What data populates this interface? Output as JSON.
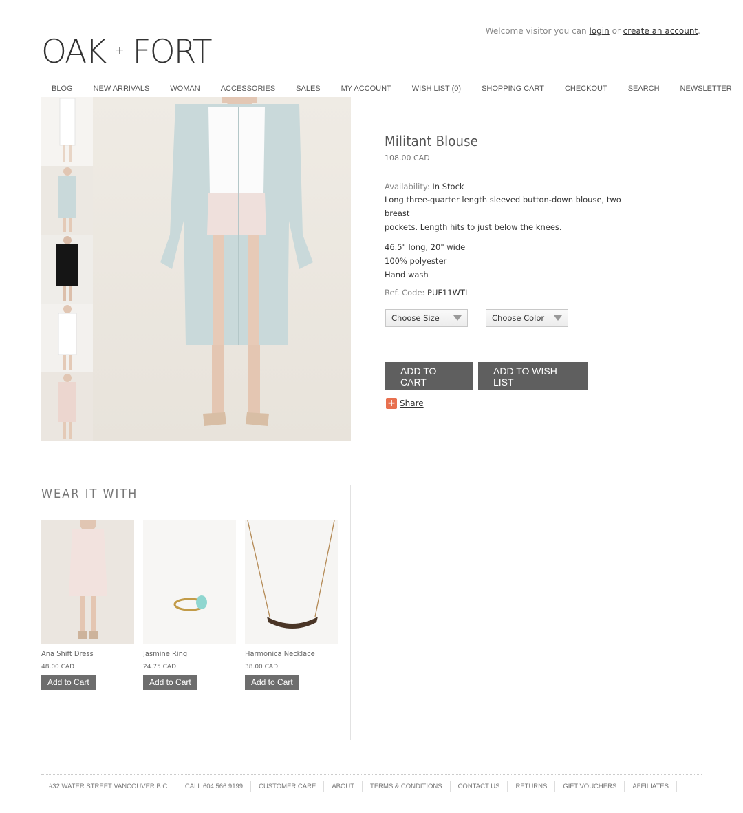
{
  "header": {
    "welcome_prefix": "Welcome visitor you can",
    "login_label": "login",
    "or_text": "or",
    "create_account_label": "create an account",
    "end_punct": ".",
    "logo_left": "OAK",
    "logo_plus": "+",
    "logo_right": "FORT"
  },
  "nav": [
    "BLOG",
    "NEW ARRIVALS",
    "WOMAN",
    "ACCESSORIES",
    "SALES",
    "MY ACCOUNT",
    "WISH LIST (0)",
    "SHOPPING CART",
    "CHECKOUT",
    "SEARCH",
    "NEWSLETTER"
  ],
  "product": {
    "title": "Militant Blouse",
    "price": "108.00 CAD",
    "availability_label": "Availability:",
    "availability_value": "In Stock",
    "description_line1": "Long three-quarter length sleeved button-down blouse, two breast",
    "description_line2": "pockets. Length hits to just below the knees.",
    "spec_1": "46.5\" long, 20\" wide",
    "spec_2": "100% polyester",
    "spec_3": "Hand wash",
    "ref_label": "Ref. Code:",
    "ref_value": "PUF11WTL",
    "size_select": "Choose Size",
    "color_select": "Choose Color",
    "add_to_cart": "ADD TO CART",
    "add_to_wishlist": "ADD TO WISH LIST",
    "share_icon": "+",
    "share_label": "Share"
  },
  "wear_it_with": {
    "title": "WEAR IT WITH",
    "items": [
      {
        "name": "Ana Shift Dress",
        "price": "48.00 CAD",
        "button": "Add to Cart"
      },
      {
        "name": "Jasmine Ring",
        "price": "24.75 CAD",
        "button": "Add to Cart"
      },
      {
        "name": "Harmonica Necklace",
        "price": "38.00 CAD",
        "button": "Add to Cart"
      }
    ]
  },
  "footer": [
    "#32 WATER STREET VANCOUVER B.C.",
    "CALL 604 566 9199",
    "CUSTOMER CARE",
    "ABOUT",
    "TERMS & CONDITIONS",
    "CONTACT US",
    "RETURNS",
    "GIFT VOUCHERS",
    "AFFILIATES"
  ],
  "colors": {
    "button_dark": "#5f5f5f",
    "share_orange": "#e8704f",
    "blouse_blue": "#c9d9da"
  }
}
